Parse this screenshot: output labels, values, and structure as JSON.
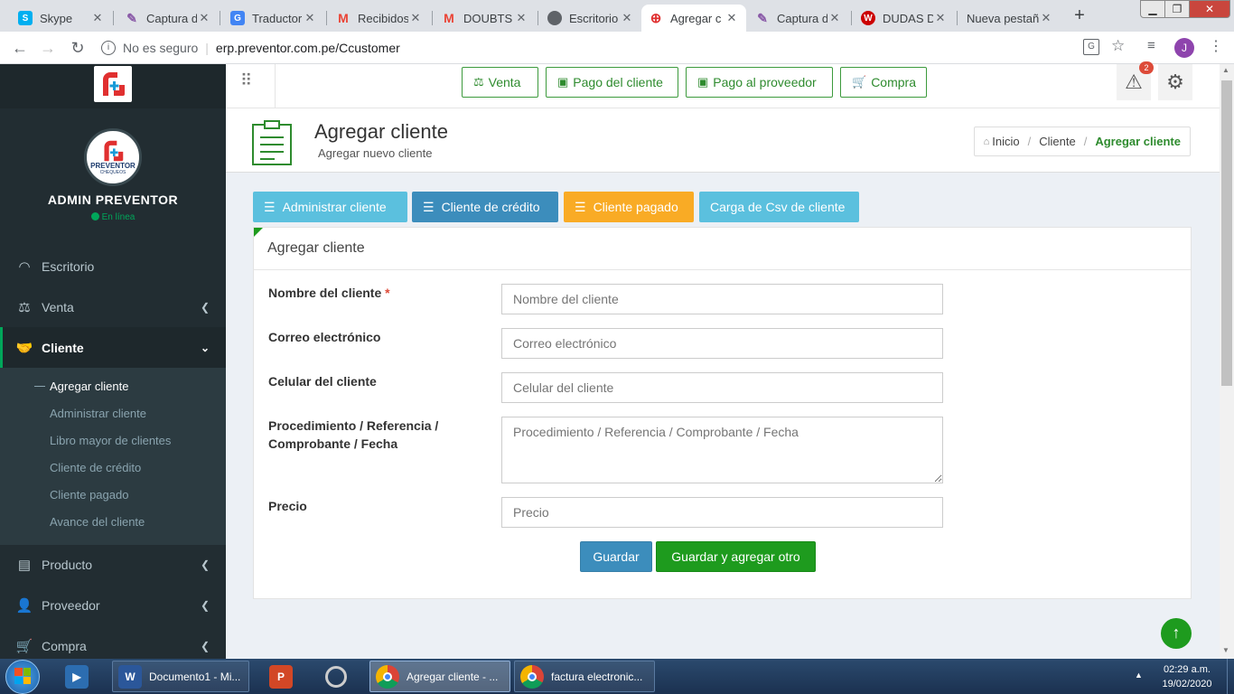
{
  "tabs": [
    {
      "title": "Skype",
      "icon": "skype-icon",
      "color": "#00aff0",
      "glyph": "S"
    },
    {
      "title": "Captura d",
      "icon": "feather-icon",
      "color": "#8a5aa8",
      "glyph": "✎"
    },
    {
      "title": "Traductor",
      "icon": "google-translate-icon",
      "color": "#4285f4",
      "glyph": "G"
    },
    {
      "title": "Recibidos",
      "icon": "gmail-icon",
      "color": "#ea4335",
      "glyph": "M"
    },
    {
      "title": "DOUBTS I",
      "icon": "gmail-icon",
      "color": "#ea4335",
      "glyph": "M"
    },
    {
      "title": "Escritorio",
      "icon": "globe-icon",
      "color": "#5f6368",
      "glyph": "◍"
    },
    {
      "title": "Agregar c",
      "icon": "preventor-icon",
      "color": "#e03030",
      "glyph": "+"
    },
    {
      "title": "Captura d",
      "icon": "feather-icon",
      "color": "#8a5aa8",
      "glyph": "✎"
    },
    {
      "title": "DUDAS D",
      "icon": "wiki-icon",
      "color": "#c00",
      "glyph": "W"
    },
    {
      "title": "Nueva pestañ",
      "icon": "",
      "color": "",
      "glyph": ""
    }
  ],
  "address": {
    "security": "No es seguro",
    "url": "erp.preventor.com.pe/Ccustomer",
    "profile": "J"
  },
  "sidebar": {
    "user_name": "ADMIN PREVENTOR",
    "status": "En línea",
    "logo_text": "PREVENTOR",
    "logo_sub": "CHEQUEOS",
    "menu": [
      {
        "label": "Escritorio",
        "icon": "dashboard-icon"
      },
      {
        "label": "Venta",
        "icon": "scale-icon"
      },
      {
        "label": "Cliente",
        "icon": "handshake-icon"
      },
      {
        "label": "Producto",
        "icon": "box-icon"
      },
      {
        "label": "Proveedor",
        "icon": "user-icon"
      },
      {
        "label": "Compra",
        "icon": "cart-icon"
      }
    ],
    "submenu": [
      "Agregar cliente",
      "Administrar cliente",
      "Libro mayor de clientes",
      "Cliente de crédito",
      "Cliente pagado",
      "Avance del cliente"
    ]
  },
  "topbar": {
    "buttons": [
      "Venta",
      "Pago del cliente",
      "Pago al proveedor",
      "Compra"
    ],
    "notification_count": "2"
  },
  "page": {
    "title": "Agregar cliente",
    "subtitle": "Agregar nuevo cliente",
    "breadcrumb": [
      "Inicio",
      "Cliente",
      "Agregar cliente"
    ]
  },
  "actions": [
    {
      "label": "Administrar cliente",
      "color": "#5bc0de"
    },
    {
      "label": "Cliente de crédito",
      "color": "#3c8dbc"
    },
    {
      "label": "Cliente pagado",
      "color": "#f9ab25"
    },
    {
      "label": "Carga de Csv de cliente",
      "color": "#5bc0de"
    }
  ],
  "form": {
    "panel_title": "Agregar cliente",
    "required_mark": "*",
    "fields": [
      {
        "label": "Nombre del cliente",
        "placeholder": "Nombre del cliente"
      },
      {
        "label": "Correo electrónico",
        "placeholder": "Correo electrónico"
      },
      {
        "label": "Celular del cliente",
        "placeholder": "Celular del cliente"
      },
      {
        "label": "Procedimiento / Referencia / Comprobante / Fecha",
        "label_line1": "Procedimiento / Referencia /",
        "label_line2": "Comprobante / Fecha",
        "placeholder": "Procedimiento / Referencia / Comprobante / Fecha"
      },
      {
        "label": "Precio",
        "placeholder": "Precio"
      }
    ],
    "save_label": "Guardar",
    "save_add_label": "Guardar y agregar otro"
  },
  "taskbar": {
    "items": [
      "Documento1 - Mi...",
      "Agregar cliente - ...",
      "factura electronic..."
    ],
    "time": "02:29 a.m.",
    "date": "19/02/2020"
  },
  "colors": {
    "green": "#2e8b2e",
    "sidebar": "#222d32",
    "primary": "#3c8dbc",
    "success": "#1e9b1e"
  }
}
